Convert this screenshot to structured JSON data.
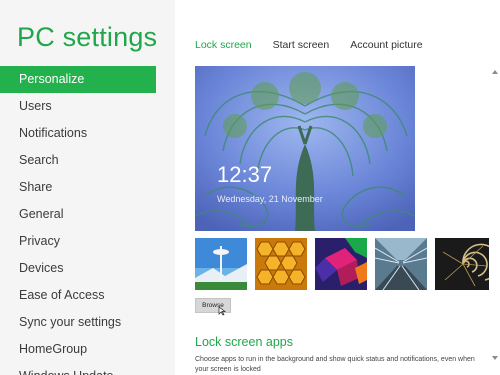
{
  "app": {
    "title": "PC settings"
  },
  "sidebar": {
    "items": [
      {
        "label": "Personalize",
        "active": true
      },
      {
        "label": "Users"
      },
      {
        "label": "Notifications"
      },
      {
        "label": "Search"
      },
      {
        "label": "Share"
      },
      {
        "label": "General"
      },
      {
        "label": "Privacy"
      },
      {
        "label": "Devices"
      },
      {
        "label": "Ease of Access"
      },
      {
        "label": "Sync your settings"
      },
      {
        "label": "HomeGroup"
      },
      {
        "label": "Windows Update"
      }
    ]
  },
  "tabs": [
    {
      "label": "Lock screen",
      "active": true
    },
    {
      "label": "Start screen"
    },
    {
      "label": "Account picture"
    }
  ],
  "lock_preview": {
    "time": "12:37",
    "date": "Wednesday, 21 November"
  },
  "thumbnails": [
    {
      "icon": "space-needle-image"
    },
    {
      "icon": "honeycomb-image"
    },
    {
      "icon": "abstract-cubes-image"
    },
    {
      "icon": "train-tunnel-image"
    },
    {
      "icon": "nautilus-shell-image"
    }
  ],
  "browse_button": {
    "label": "Browse"
  },
  "lock_screen_apps": {
    "title": "Lock screen apps",
    "description": "Choose apps to run in the background and show quick status and notifications, even when your screen is locked"
  },
  "colors": {
    "accent": "#22b14c",
    "accent_text": "#1fa74a"
  }
}
